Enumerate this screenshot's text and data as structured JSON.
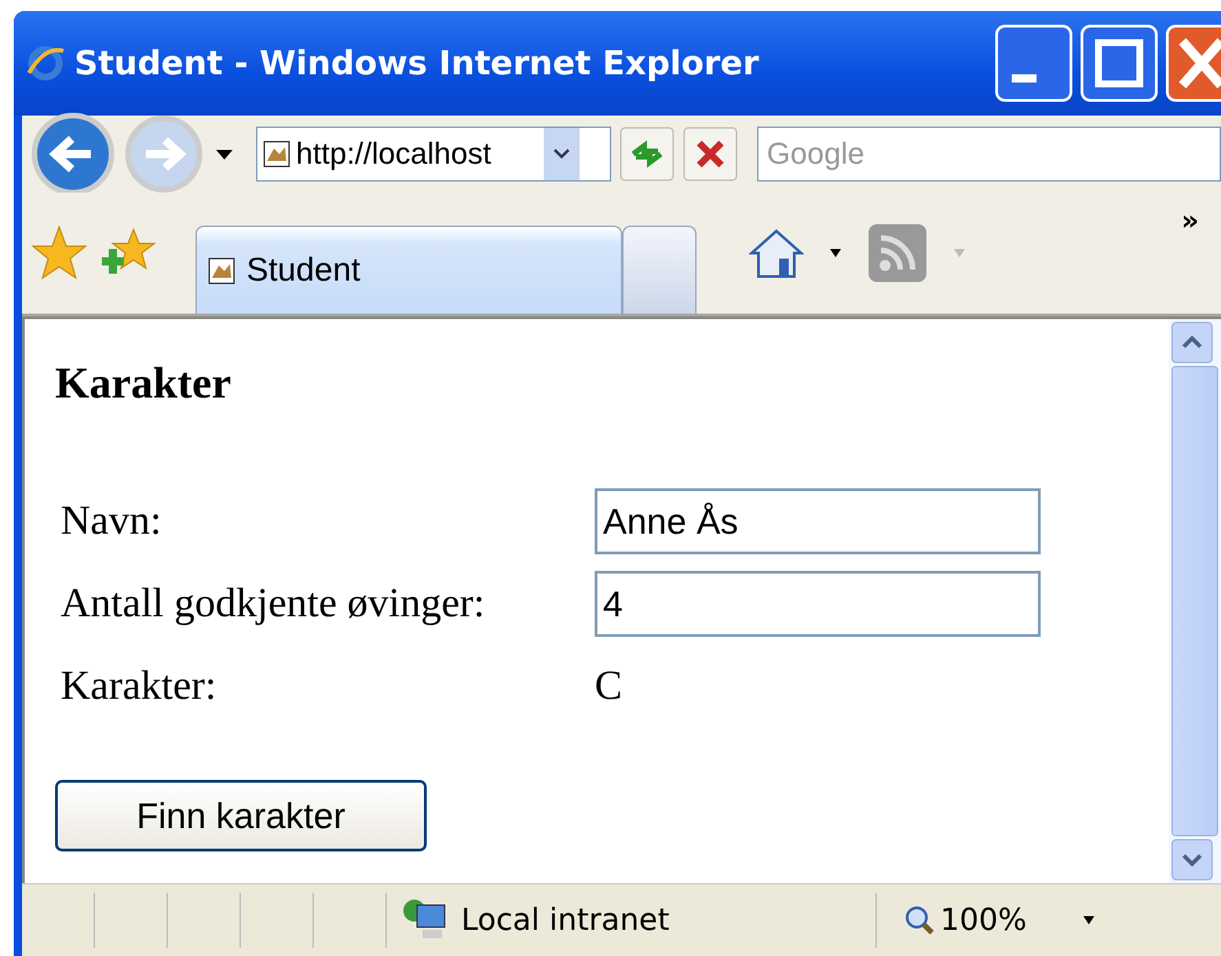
{
  "window": {
    "title": "Student - Windows Internet Explorer"
  },
  "address_bar": {
    "value": "http://localhost"
  },
  "search": {
    "placeholder": "Google"
  },
  "tabs": [
    {
      "label": "Student",
      "selected": true
    },
    {
      "selected": false
    }
  ],
  "more_chevron": "»",
  "page": {
    "heading": "Karakter",
    "fields": [
      {
        "label": "Navn:",
        "value": "Anne Ås",
        "kind": "input"
      },
      {
        "label": "Antall godkjente øvinger:",
        "value": "4",
        "kind": "input"
      },
      {
        "label": "Karakter:",
        "value": "C",
        "kind": "text"
      }
    ],
    "button": "Finn karakter"
  },
  "status_bar": {
    "zone": "Local intranet",
    "zoom": "100%"
  }
}
